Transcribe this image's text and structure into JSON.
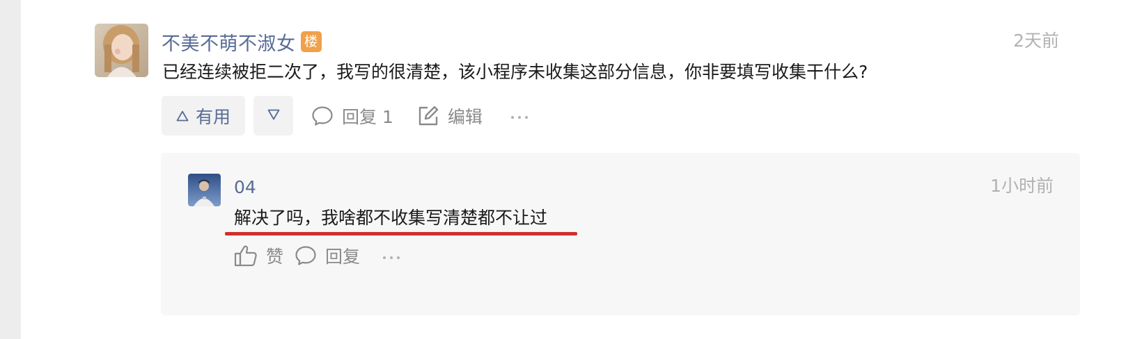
{
  "comment": {
    "author": "不美不萌不淑女",
    "badge": "楼",
    "time": "2天前",
    "content": "已经连续被拒二次了，我写的很清楚，该小程序未收集这部分信息，你非要填写收集干什么?",
    "actions": {
      "useful_label": "有用",
      "reply_label": "回复 1",
      "edit_label": "编辑"
    }
  },
  "reply": {
    "author": "04",
    "time": "1小时前",
    "content": "解决了吗，我啥都不收集写清楚都不让过",
    "actions": {
      "like_label": "赞",
      "reply_label": "回复"
    }
  },
  "colors": {
    "link": "#576b95",
    "badge": "#f0a14a",
    "highlight": "#d0302a",
    "muted": "#8a8a8a"
  },
  "icons": [
    "triangle-up-icon",
    "triangle-down-icon",
    "comment-bubble-icon",
    "edit-icon",
    "more-dots-icon",
    "thumbs-up-icon"
  ]
}
